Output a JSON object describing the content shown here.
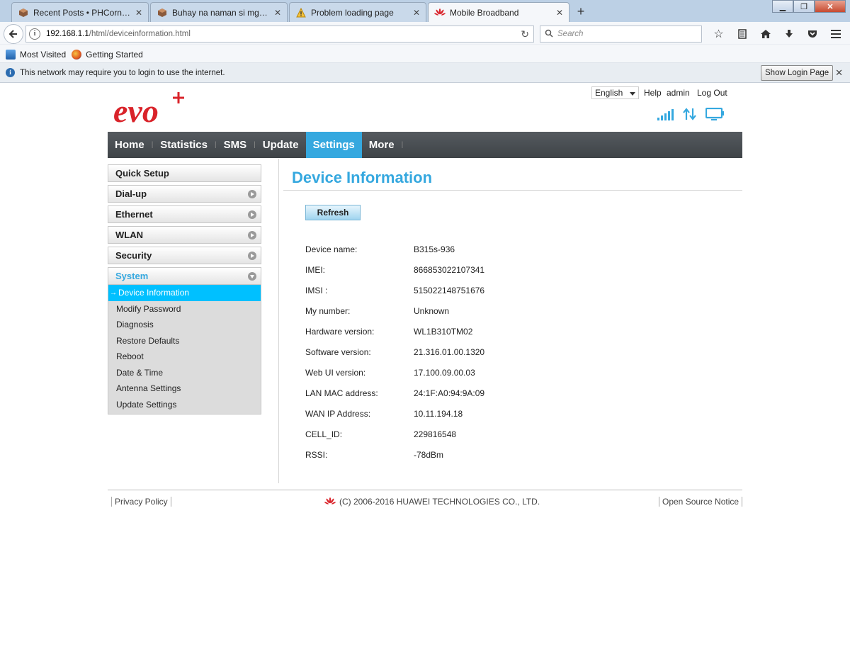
{
  "browser": {
    "tabs": [
      {
        "title": "Recent Posts • PHCorner C...",
        "icon": "phcorner-icon"
      },
      {
        "title": "Buhay na naman si mgc.. •...",
        "icon": "phcorner-icon"
      },
      {
        "title": "Problem loading page",
        "icon": "warning-icon"
      },
      {
        "title": "Mobile Broadband",
        "icon": "huawei-icon"
      }
    ],
    "new_tab": "+",
    "url_host": "192.168.1.1",
    "url_path": "/html/deviceinformation.html",
    "search_placeholder": "Search",
    "bookmarks": [
      "Most Visited",
      "Getting Started"
    ],
    "notification": "This network may require you to login to use the internet.",
    "login_button": "Show Login Page"
  },
  "header": {
    "logo_text": "evo",
    "language": "English",
    "help": "Help",
    "user": "admin",
    "logout": "Log Out"
  },
  "nav": [
    "Home",
    "Statistics",
    "SMS",
    "Update",
    "Settings",
    "More"
  ],
  "nav_active": "Settings",
  "sidebar": {
    "items": [
      "Quick Setup",
      "Dial-up",
      "Ethernet",
      "WLAN",
      "Security"
    ],
    "open_item": "System",
    "subitems": [
      "Device Information",
      "Modify Password",
      "Diagnosis",
      "Restore Defaults",
      "Reboot",
      "Date & Time",
      "Antenna Settings",
      "Update Settings"
    ],
    "active_prefix": "→"
  },
  "content": {
    "title": "Device Information",
    "refresh": "Refresh",
    "rows": [
      {
        "label": "Device name:",
        "value": "B315s-936"
      },
      {
        "label": "IMEI:",
        "value": "866853022107341"
      },
      {
        "label": "IMSI :",
        "value": "515022148751676"
      },
      {
        "label": "My number:",
        "value": "Unknown"
      },
      {
        "label": "Hardware version:",
        "value": "WL1B310TM02"
      },
      {
        "label": "Software version:",
        "value": "21.316.01.00.1320"
      },
      {
        "label": "Web UI version:",
        "value": "17.100.09.00.03"
      },
      {
        "label": "LAN MAC address:",
        "value": "24:1F:A0:94:9A:09"
      },
      {
        "label": "WAN IP Address:",
        "value": "10.11.194.18"
      },
      {
        "label": "CELL_ID:",
        "value": "229816548"
      },
      {
        "label": "RSSI:",
        "value": "-78dBm"
      }
    ]
  },
  "footer": {
    "privacy": "Privacy Policy",
    "copyright": "(C) 2006-2016 HUAWEI TECHNOLOGIES CO., LTD.",
    "open_source": "Open Source Notice"
  },
  "colors": {
    "accent": "#35a8df",
    "active_sub": "#00c0ff",
    "logo_red": "#d9232a"
  }
}
